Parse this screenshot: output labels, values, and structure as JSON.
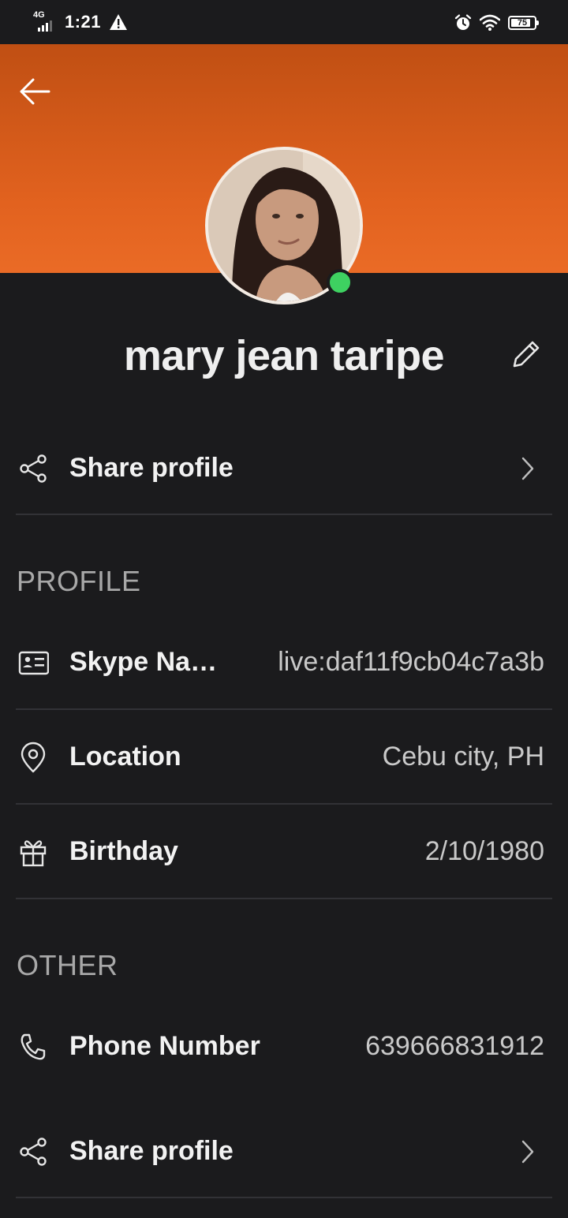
{
  "status_bar": {
    "network": "4G",
    "time": "1:21",
    "battery_level": "75",
    "icons": [
      "signal-icon",
      "warning-icon",
      "alarm-icon",
      "wifi-icon",
      "battery-icon"
    ]
  },
  "header": {
    "accent_color": "#e2621f",
    "presence_color": "#3ed161"
  },
  "profile": {
    "name": "mary jean taripe"
  },
  "share_top": {
    "label": "Share profile"
  },
  "sections": {
    "profile_title": "PROFILE",
    "other_title": "OTHER"
  },
  "fields": {
    "skype_name": {
      "label": "Skype Na…",
      "value": "live:daf11f9cb04c7a3b"
    },
    "location": {
      "label": "Location",
      "value": "Cebu city, PH"
    },
    "birthday": {
      "label": "Birthday",
      "value": "2/10/1980"
    },
    "phone": {
      "label": "Phone Number",
      "value": "639666831912"
    }
  },
  "share_bottom": {
    "label": "Share profile"
  }
}
